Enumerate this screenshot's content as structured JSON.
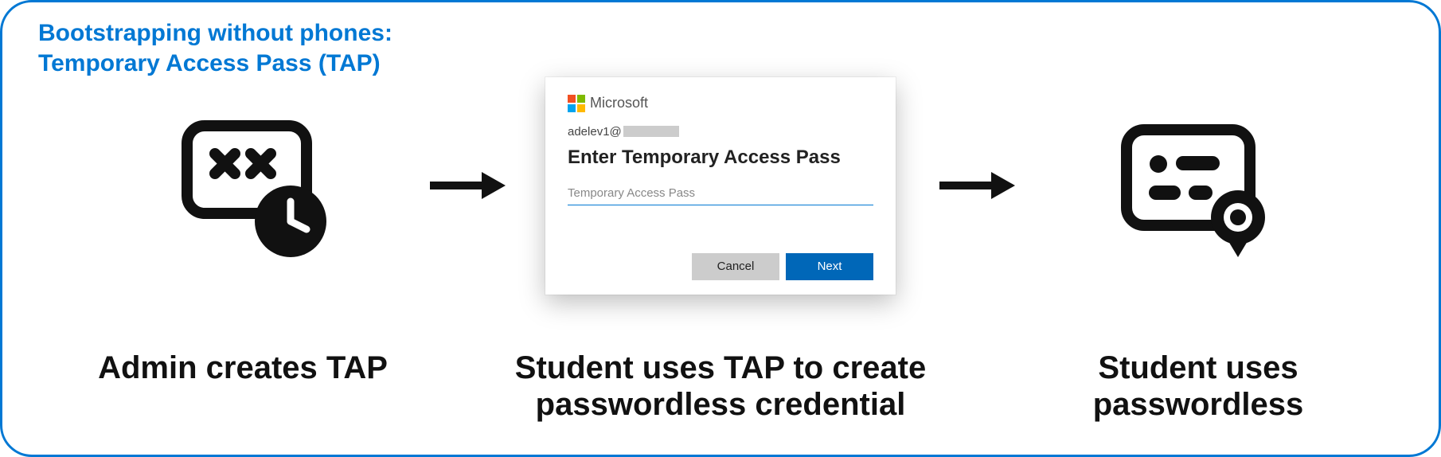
{
  "title_line1": "Bootstrapping without phones:",
  "title_line2": "Temporary Access Pass (TAP)",
  "brand_name": "Microsoft",
  "account_prefix": "adelev1@",
  "dialog_heading": "Enter Temporary Access Pass",
  "tap_placeholder": "Temporary Access Pass",
  "btn_cancel": "Cancel",
  "btn_next": "Next",
  "caption1": "Admin creates TAP",
  "caption2_line1": "Student uses TAP to create",
  "caption2_line2": "passwordless credential",
  "caption3_line1": "Student uses",
  "caption3_line2": "passwordless",
  "icons": {
    "left": "tap-clock-icon",
    "right": "credential-badge-icon",
    "arrow": "arrow-right-icon",
    "ms_logo": "microsoft-logo-icon"
  }
}
